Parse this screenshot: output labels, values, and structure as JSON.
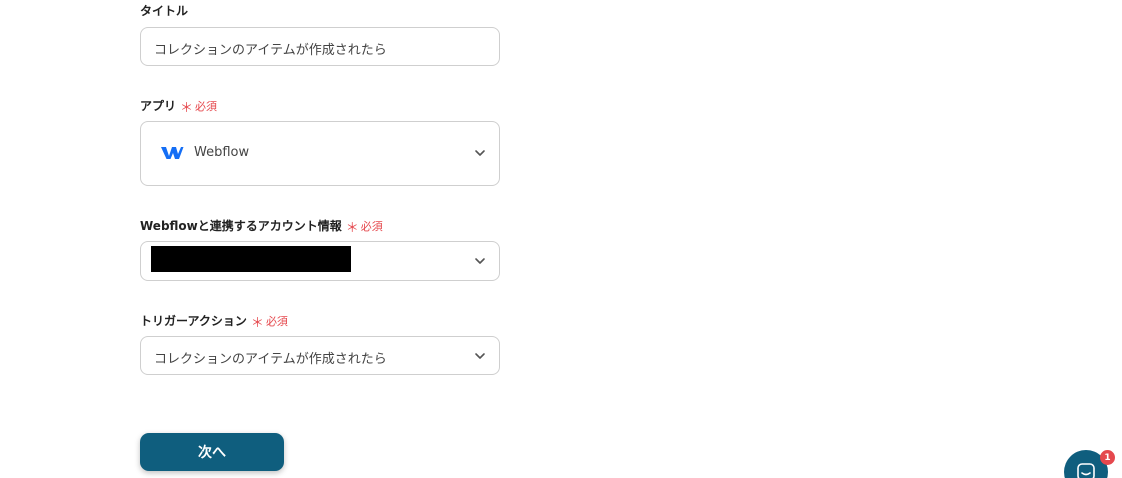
{
  "form": {
    "title": {
      "label": "タイトル",
      "value": "コレクションのアイテムが作成されたら"
    },
    "app": {
      "label": "アプリ",
      "required_mark": "＊",
      "required_text": "必須",
      "selected": "Webflow",
      "logo_icon": "webflow-logo-icon"
    },
    "account": {
      "label": "Webflowと連携するアカウント情報",
      "required_mark": "＊",
      "required_text": "必須"
    },
    "trigger_action": {
      "label": "トリガーアクション",
      "required_mark": "＊",
      "required_text": "必須",
      "selected": "コレクションのアイテムが作成されたら"
    }
  },
  "next_button": {
    "label": "次へ"
  },
  "chat": {
    "icon": "chat-icon",
    "badge_count": "1"
  },
  "colors": {
    "primary": "#0f5e7e",
    "required": "#e5484d",
    "border": "#cfcfcf",
    "webflow_blue": "#146ef5"
  }
}
